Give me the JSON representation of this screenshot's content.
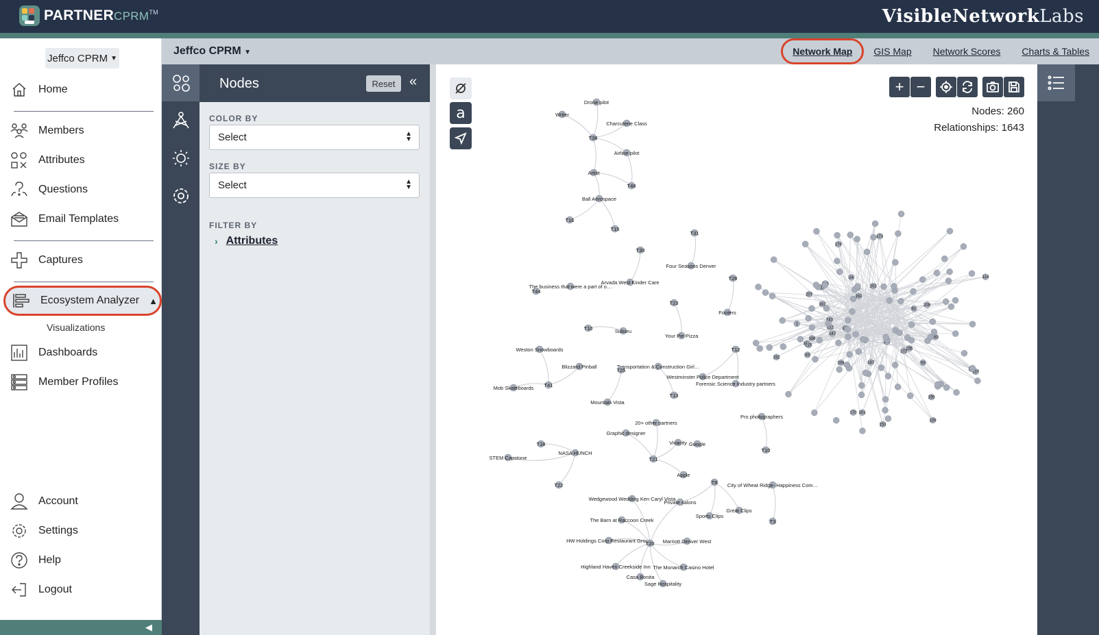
{
  "app": {
    "logo_text": "PARTNER",
    "logo_sub": "CPRM",
    "logo_tm": "TM",
    "brand_right_bold": "Visible",
    "brand_right_mid": "Network",
    "brand_right_thin": "Labs"
  },
  "sidebar": {
    "org_select": "Jeffco CPRM",
    "items": [
      {
        "label": "Home",
        "icon": "home-icon"
      },
      {
        "label": "Members",
        "icon": "members-icon"
      },
      {
        "label": "Attributes",
        "icon": "attributes-icon"
      },
      {
        "label": "Questions",
        "icon": "questions-icon"
      },
      {
        "label": "Email Templates",
        "icon": "email-icon"
      },
      {
        "label": "Captures",
        "icon": "captures-icon"
      },
      {
        "label": "Ecosystem Analyzer",
        "icon": "ecosystem-icon"
      },
      {
        "label": "Dashboards",
        "icon": "dashboard-icon"
      },
      {
        "label": "Member Profiles",
        "icon": "profiles-icon"
      },
      {
        "label": "Account",
        "icon": "account-icon"
      },
      {
        "label": "Settings",
        "icon": "settings-icon"
      },
      {
        "label": "Help",
        "icon": "help-icon"
      },
      {
        "label": "Logout",
        "icon": "logout-icon"
      }
    ],
    "sub_visualizations": "Visualizations"
  },
  "header": {
    "project": "Jeffco CPRM",
    "tabs": [
      "Network Map",
      "GIS Map",
      "Network Scores",
      "Charts & Tables"
    ]
  },
  "panel": {
    "title": "Nodes",
    "reset": "Reset",
    "color_by_label": "COLOR BY",
    "color_by_value": "Select",
    "size_by_label": "SIZE BY",
    "size_by_value": "Select",
    "filter_by_label": "FILTER BY",
    "filter_attributes": "Attributes"
  },
  "map": {
    "nodes_stat": "Nodes: 260",
    "relationships_stat": "Relationships: 1643",
    "labels": [
      "Drone pilot",
      "Writer",
      "Charcuterie Class",
      "T38",
      "Airline pilot",
      "Artist",
      "T48",
      "Ball Aerospace",
      "T16",
      "T15",
      "T31",
      "T30",
      "Four Seasons Denver",
      "T28",
      "Arvada West Kinder Care",
      "The business that were a part of our \"Career Fair\" last Spring",
      "T44",
      "T23",
      "Footers",
      "T10",
      "Subaru",
      "Your Pie Pizza",
      "Weston Snowboards",
      "T12",
      "Blizzard Pinball",
      "Transportation & Construction Girl (Hoya Foundation)",
      "T25",
      "Westminster Police Department",
      "Forensic Science Industry partners",
      "Mob Skateboards",
      "T41",
      "T13",
      "Mountain Vista",
      "20+ other partners",
      "Pro photographers",
      "Graphic designer",
      "T18",
      "Vivacity",
      "Google",
      "NASA HUNCH",
      "STEM Capstone",
      "T21",
      "T10",
      "Apple",
      "T22",
      "T8",
      "City of Wheat Ridge- Happiness Community garden",
      "Wedgewood Wedding Ken Caryl Vista",
      "Private salons",
      "Sports Clips",
      "Great Clips",
      "The Barn at Raccoon Creek",
      "T3",
      "HW Holdings Corp Restaurant Group",
      "T20",
      "Marriott Denver West",
      "Highland Haven Creekside Inn",
      "The Monarch Casino Hotel",
      "Casa Bonita",
      "Sage Hospitality"
    ],
    "cluster_numbers": [
      "1",
      "156",
      "166",
      "203",
      "217",
      "170",
      "162",
      "143",
      "180",
      "207",
      "191",
      "114",
      "59",
      "61",
      "83",
      "24",
      "109",
      "147",
      "167",
      "195",
      "206",
      "137",
      "153",
      "212",
      "196",
      "173",
      "172",
      "125",
      "163",
      "176",
      "209",
      "215",
      "192",
      "186",
      "187",
      "202",
      "201"
    ]
  }
}
